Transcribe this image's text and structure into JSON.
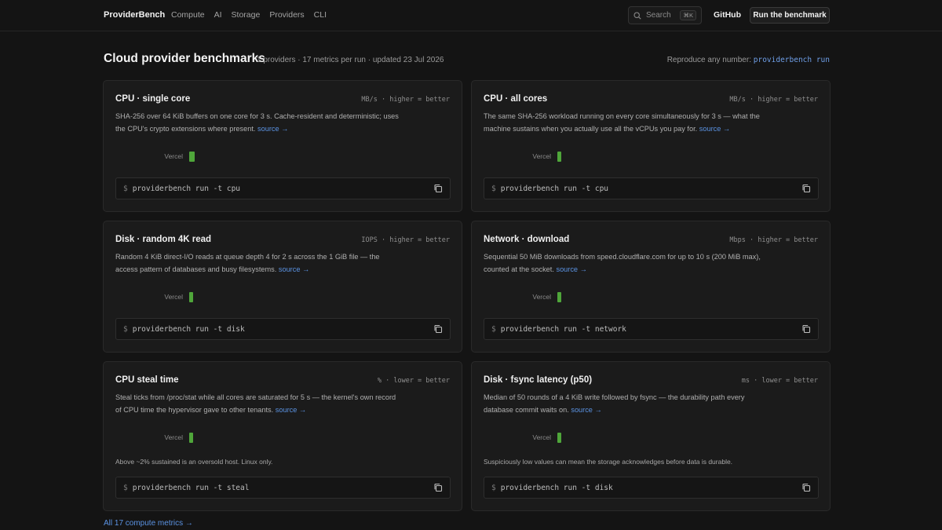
{
  "nav": {
    "brand": "ProviderBench",
    "links": [
      "Compute",
      "AI",
      "Storage",
      "Providers",
      "CLI"
    ],
    "search_label": "Search",
    "search_shortcut": "⌘K",
    "github": "GitHub",
    "run_button": "Run the benchmark"
  },
  "header": {
    "title": "Cloud provider benchmarks",
    "meta": "1 providers · 17 metrics per run · updated 23 Jul 2026",
    "repro_label": "Reproduce any number:",
    "repro_cmd": "providerbench run"
  },
  "accent": {
    "bar": "#4fa63a",
    "link": "#5b93e3"
  },
  "cards": [
    {
      "title": "CPU · single core",
      "unit": "MB/s · higher = better",
      "desc": "SHA-256 over 64 KiB buffers on one core for 3 s. Cache-resident and deterministic; uses the CPU's crypto extensions where present.",
      "source": "source →",
      "bar_label": "Vercel",
      "bar_fraction": 0.035,
      "note": "",
      "command": "providerbench run -t cpu",
      "prompt": "$"
    },
    {
      "title": "CPU · all cores",
      "unit": "MB/s · higher = better",
      "desc": "The same SHA-256 workload running on every core simultaneously for 3 s — what the machine sustains when you actually use all the vCPUs you pay for.",
      "source": "source →",
      "bar_label": "Vercel",
      "bar_fraction": 0.018,
      "note": "",
      "command": "providerbench run -t cpu",
      "prompt": "$"
    },
    {
      "title": "Disk · random 4K read",
      "unit": "IOPS · higher = better",
      "desc": "Random 4 KiB direct-I/O reads at queue depth 4 for 2 s across the 1 GiB file — the access pattern of databases and busy filesystems.",
      "source": "source →",
      "bar_label": "Vercel",
      "bar_fraction": 0.018,
      "note": "",
      "command": "providerbench run -t disk",
      "prompt": "$"
    },
    {
      "title": "Network · download",
      "unit": "Mbps · higher = better",
      "desc": "Sequential 50 MiB downloads from speed.cloudflare.com for up to 10 s (200 MiB max), counted at the socket.",
      "source": "source →",
      "bar_label": "Vercel",
      "bar_fraction": 0.018,
      "note": "",
      "command": "providerbench run -t network",
      "prompt": "$"
    },
    {
      "title": "CPU steal time",
      "unit": "% · lower = better",
      "desc": "Steal ticks from /proc/stat while all cores are saturated for 5 s — the kernel's own record of CPU time the hypervisor gave to other tenants.",
      "source": "source →",
      "bar_label": "Vercel",
      "bar_fraction": 0.018,
      "note": "Above ~2% sustained is an oversold host. Linux only.",
      "command": "providerbench run -t steal",
      "prompt": "$"
    },
    {
      "title": "Disk · fsync latency (p50)",
      "unit": "ms · lower = better",
      "desc": "Median of 50 rounds of a 4 KiB write followed by fsync — the durability path every database commit waits on.",
      "source": "source →",
      "bar_label": "Vercel",
      "bar_fraction": 0.018,
      "note": "Suspiciously low values can mean the storage acknowledges before data is durable.",
      "command": "providerbench run -t disk",
      "prompt": "$"
    }
  ],
  "footer_link": "All 17 compute metrics →"
}
